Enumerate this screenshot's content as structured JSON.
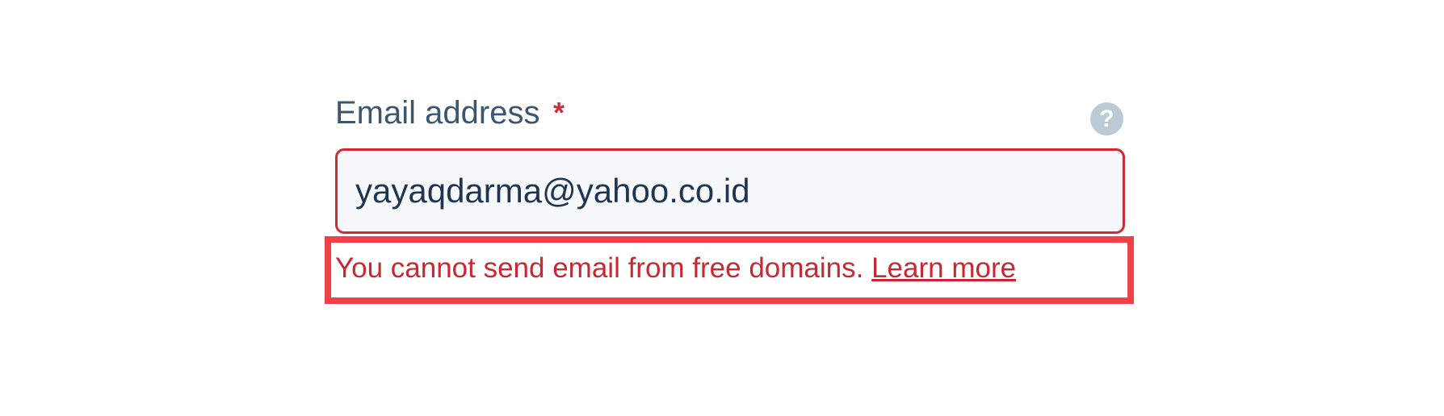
{
  "field": {
    "label": "Email address",
    "required_marker": "*",
    "help_icon": "?",
    "value": "yayaqdarma@yahoo.co.id"
  },
  "error": {
    "message": "You cannot send email from free domains.",
    "link_text": "Learn more"
  },
  "colors": {
    "label": "#3c5670",
    "error": "#cc2631",
    "highlight_border": "#ef4148",
    "input_background": "#f6f8fb",
    "help_icon": "#bccad6"
  }
}
